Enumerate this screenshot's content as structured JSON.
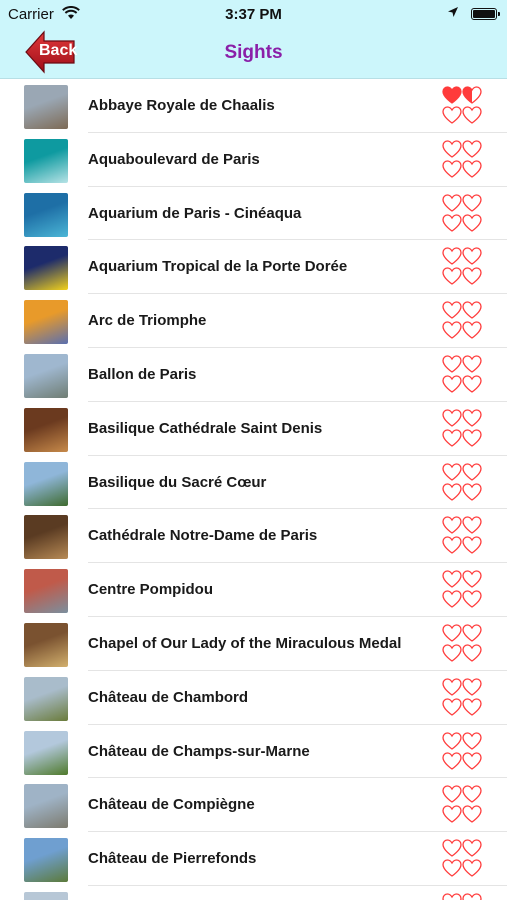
{
  "status_bar": {
    "carrier": "Carrier",
    "time": "3:37 PM"
  },
  "nav": {
    "back_label": "Back",
    "title": "Sights"
  },
  "colors": {
    "header_bg": "#ccf6fb",
    "title": "#8a1fa8",
    "back_button": "#c8102e",
    "heart": "#ff3b3b"
  },
  "sights": [
    {
      "name": "Abbaye Royale de Chaalis",
      "favorite_level": 1.5,
      "thumb": [
        "#9aa7b4",
        "#7d6a55"
      ]
    },
    {
      "name": "Aquaboulevard de Paris",
      "favorite_level": 0,
      "thumb": [
        "#0e9aa0",
        "#b7e3e6"
      ]
    },
    {
      "name": "Aquarium de Paris - Cinéaqua",
      "favorite_level": 0,
      "thumb": [
        "#1e6fa6",
        "#4bb6d6"
      ]
    },
    {
      "name": "Aquarium Tropical de la Porte Dorée",
      "favorite_level": 0,
      "thumb": [
        "#1d2b6b",
        "#f2d21b"
      ]
    },
    {
      "name": "Arc de Triomphe",
      "favorite_level": 0,
      "thumb": [
        "#e89a2a",
        "#5a6fb0"
      ]
    },
    {
      "name": "Ballon de Paris",
      "favorite_level": 0,
      "thumb": [
        "#9fb7cf",
        "#6f7d73"
      ]
    },
    {
      "name": "Basilique Cathédrale Saint Denis",
      "favorite_level": 0,
      "thumb": [
        "#6b3a1f",
        "#c78a4a"
      ]
    },
    {
      "name": "Basilique du Sacré Cœur",
      "favorite_level": 0,
      "thumb": [
        "#8fb6d9",
        "#3f6b2f"
      ]
    },
    {
      "name": "Cathédrale Notre-Dame de Paris",
      "favorite_level": 0,
      "thumb": [
        "#5a3b22",
        "#b78a55"
      ]
    },
    {
      "name": "Centre Pompidou",
      "favorite_level": 0,
      "thumb": [
        "#c05a4a",
        "#7b8f9e"
      ]
    },
    {
      "name": "Chapel of Our Lady of the Miraculous Medal",
      "favorite_level": 0,
      "thumb": [
        "#7a5230",
        "#d2b06e"
      ]
    },
    {
      "name": "Château de Chambord",
      "favorite_level": 0,
      "thumb": [
        "#a9bccb",
        "#6a7b3a"
      ]
    },
    {
      "name": "Château de Champs-sur-Marne",
      "favorite_level": 0,
      "thumb": [
        "#b3c8dc",
        "#4f7a2b"
      ]
    },
    {
      "name": "Château de Compiègne",
      "favorite_level": 0,
      "thumb": [
        "#9fb3c6",
        "#7c7a6e"
      ]
    },
    {
      "name": "Château de Pierrefonds",
      "favorite_level": 0,
      "thumb": [
        "#6f9fd0",
        "#5c7a3a"
      ]
    },
    {
      "name": "",
      "favorite_level": 0,
      "thumb": [
        "#b7c7d6",
        "#8f9aa3"
      ]
    }
  ]
}
